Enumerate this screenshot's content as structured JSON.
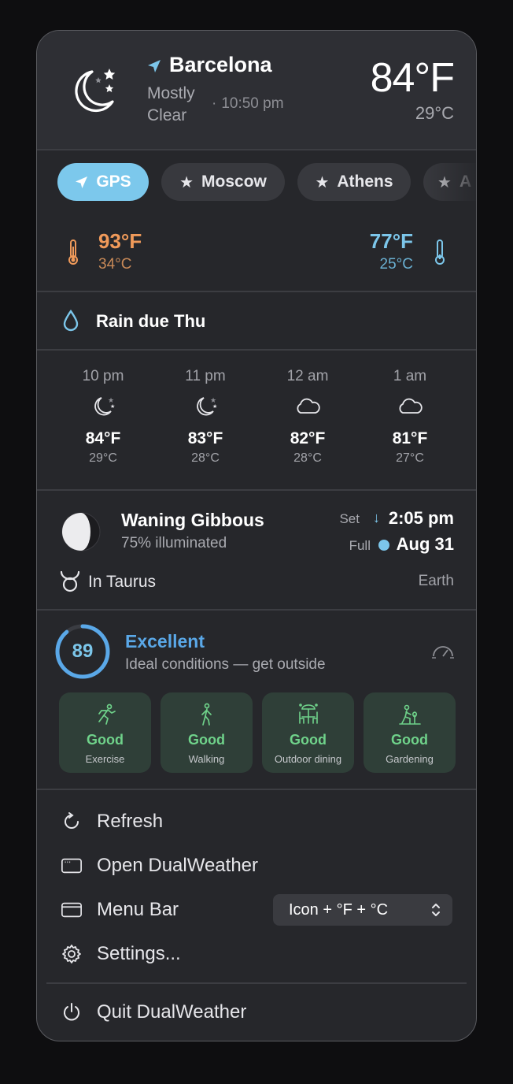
{
  "header": {
    "city": "Barcelona",
    "condition": "Mostly Clear",
    "time": "10:50 pm",
    "time_separator": "·",
    "temp_f": "84°F",
    "temp_c": "29°C",
    "icon": "moon-stars-icon"
  },
  "locations": [
    {
      "label": "GPS",
      "icon": "location-arrow-icon",
      "active": true
    },
    {
      "label": "Moscow",
      "icon": "star-icon",
      "active": false
    },
    {
      "label": "Athens",
      "icon": "star-icon",
      "active": false
    },
    {
      "label": "A",
      "icon": "star-icon",
      "active": false
    }
  ],
  "hilo": {
    "high_f": "93°F",
    "high_c": "34°C",
    "low_f": "77°F",
    "low_c": "25°C",
    "high_color": "#f09a5a",
    "low_color": "#7cc6ea"
  },
  "rain": {
    "text": "Rain due Thu",
    "icon": "raindrop-icon"
  },
  "hourly": [
    {
      "hour": "10 pm",
      "icon": "moon-stars-icon",
      "f": "84°F",
      "c": "29°C"
    },
    {
      "hour": "11 pm",
      "icon": "moon-stars-icon",
      "f": "83°F",
      "c": "28°C"
    },
    {
      "hour": "12 am",
      "icon": "cloud-icon",
      "f": "82°F",
      "c": "28°C"
    },
    {
      "hour": "1 am",
      "icon": "cloud-icon",
      "f": "81°F",
      "c": "27°C"
    }
  ],
  "moon": {
    "phase": "Waning Gibbous",
    "illumination": "75% illuminated",
    "set_label": "Set",
    "set_time": "2:05 pm",
    "full_label": "Full",
    "full_date": "Aug 31",
    "zodiac": "In Taurus",
    "reference": "Earth",
    "zodiac_icon": "taurus-icon"
  },
  "outdoor": {
    "score": "89",
    "score_fraction": 0.89,
    "rating": "Excellent",
    "description": "Ideal conditions — get outside",
    "activities": [
      {
        "rating": "Good",
        "name": "Exercise",
        "icon": "running-icon"
      },
      {
        "rating": "Good",
        "name": "Walking",
        "icon": "walking-icon"
      },
      {
        "rating": "Good",
        "name": "Outdoor dining",
        "icon": "outdoor-dining-icon"
      },
      {
        "rating": "Good",
        "name": "Gardening",
        "icon": "gardening-icon"
      }
    ],
    "accent": "#5aa8e8",
    "good_color": "#6fd28a"
  },
  "menu": {
    "refresh": "Refresh",
    "open": "Open DualWeather",
    "menubar": "Menu Bar",
    "menubar_value": "Icon + °F + °C",
    "settings": "Settings...",
    "quit": "Quit DualWeather"
  }
}
